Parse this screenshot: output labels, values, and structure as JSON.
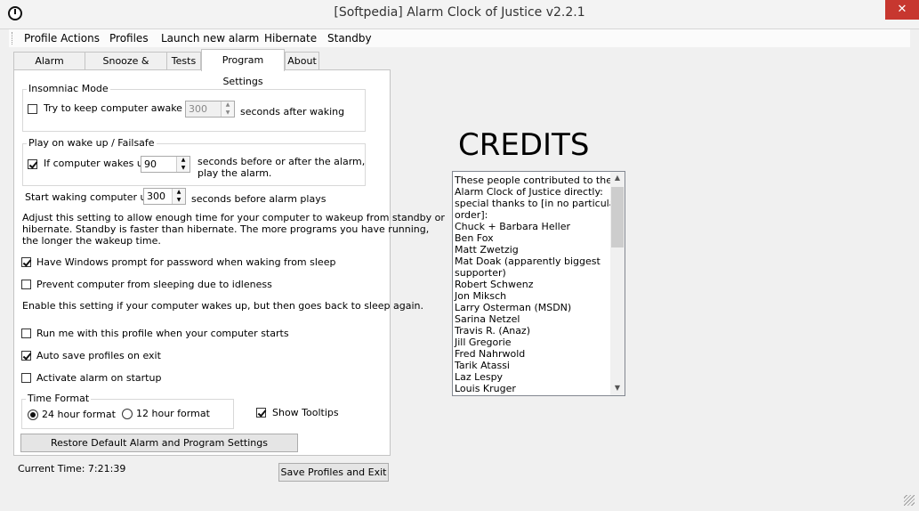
{
  "window": {
    "title": "[Softpedia] Alarm Clock of Justice v2.2.1",
    "close_glyph": "✕"
  },
  "menu": [
    "Profile Actions",
    "Profiles",
    "Launch new alarm",
    "Hibernate",
    "Standby"
  ],
  "tabs": [
    "Alarm Settings",
    "Snooze & Timing",
    "Tests",
    "Program Settings",
    "About"
  ],
  "insomniac": {
    "group_label": "Insomniac Mode",
    "checkbox_label": "Try to keep computer awake for",
    "value": "300",
    "suffix": "seconds after waking"
  },
  "playwake": {
    "group_label": "Play on wake up / Failsafe",
    "checkbox_label": "If computer wakes up",
    "value": "90",
    "suffix_line1": "seconds before or after the alarm,",
    "suffix_line2": "play the alarm."
  },
  "startwaking": {
    "label": "Start waking computer up",
    "value": "300",
    "suffix": "seconds before alarm plays"
  },
  "adjust_text": {
    "line1": "Adjust this setting to allow enough time for your computer to wakeup from standby or",
    "line2": "hibernate.  Standby is faster than hibernate.  The more programs you have running,",
    "line3": "the longer the wakeup time."
  },
  "options": {
    "password_prompt": "Have Windows prompt for password when waking from sleep",
    "prevent_sleep": "Prevent computer from sleeping due to idleness",
    "enable_text": "Enable this setting if your computer wakes up, but then goes back to sleep again.",
    "run_startup": "Run me with this profile when your computer starts",
    "auto_save": "Auto save profiles on exit",
    "activate_startup": "Activate alarm on startup"
  },
  "time_format": {
    "group_label": "Time Format",
    "h24": "24 hour format",
    "h12": "12 hour format"
  },
  "show_tooltips": "Show Tooltips",
  "restore_button": "Restore Default Alarm and Program Settings",
  "status": {
    "current_time": "Current Time: 7:21:39"
  },
  "save_exit_button": "Save Profiles and Exit",
  "credits": {
    "title": "CREDITS",
    "lines": [
      "These people contributed to the",
      "Alarm Clock of Justice directly:",
      "special thanks to [in no particular",
      "order]:",
      "Chuck + Barbara Heller",
      "Ben Fox",
      "Matt Zwetzig",
      "Mat Doak (apparently biggest",
      "supporter)",
      "Robert Schwenz",
      "Jon Miksch",
      "Larry Osterman (MSDN)",
      "Sarina Netzel",
      "Travis R. (Anaz)",
      "Jill Gregorie",
      "Fred Nahrwold",
      "Tarik Atassi",
      "Laz Lespy",
      "Louis Kruger"
    ]
  }
}
